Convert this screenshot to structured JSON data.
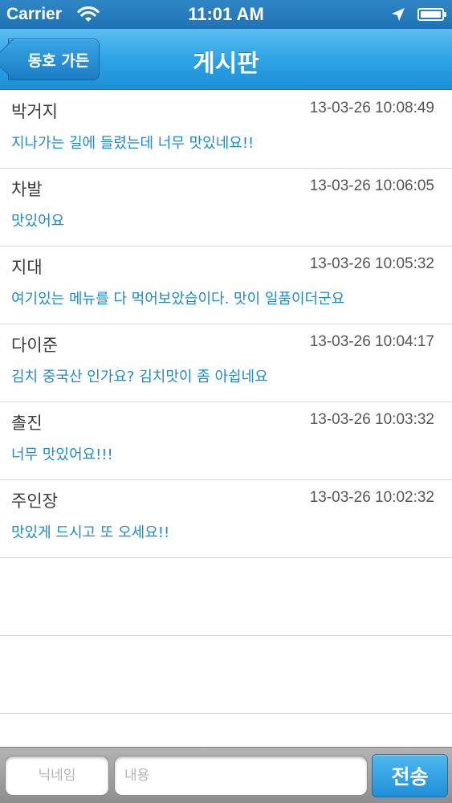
{
  "status_bar": {
    "carrier": "Carrier",
    "time": "11:01 AM"
  },
  "nav": {
    "back_label": "동호 가든",
    "title": "게시판"
  },
  "posts": [
    {
      "author": "박거지",
      "time": "13-03-26 10:08:49",
      "message": "지나가는 길에 들렸는데 너무 맛있네요!!"
    },
    {
      "author": "차발",
      "time": "13-03-26 10:06:05",
      "message": "맛있어요"
    },
    {
      "author": "지대",
      "time": "13-03-26 10:05:32",
      "message": "여기있는 메뉴를 다 먹어보았습이다. 맛이 일품이더군요"
    },
    {
      "author": "다이준",
      "time": "13-03-26 10:04:17",
      "message": "김치 중국산 인가요? 김치맛이 좀 아쉽네요"
    },
    {
      "author": "촐진",
      "time": "13-03-26 10:03:32",
      "message": "너무 맛있어요!!!"
    },
    {
      "author": "주인장",
      "time": "13-03-26 10:02:32",
      "message": "맛있게 드시고 또 오세요!!"
    }
  ],
  "input_bar": {
    "nickname_placeholder": "닉네임",
    "content_placeholder": "내용",
    "send_label": "전송"
  },
  "colors": {
    "accent": "#1a8ad4",
    "nav_blue": "#2fa4e6"
  },
  "icons": [
    "wifi-icon",
    "location-icon",
    "battery-icon"
  ]
}
